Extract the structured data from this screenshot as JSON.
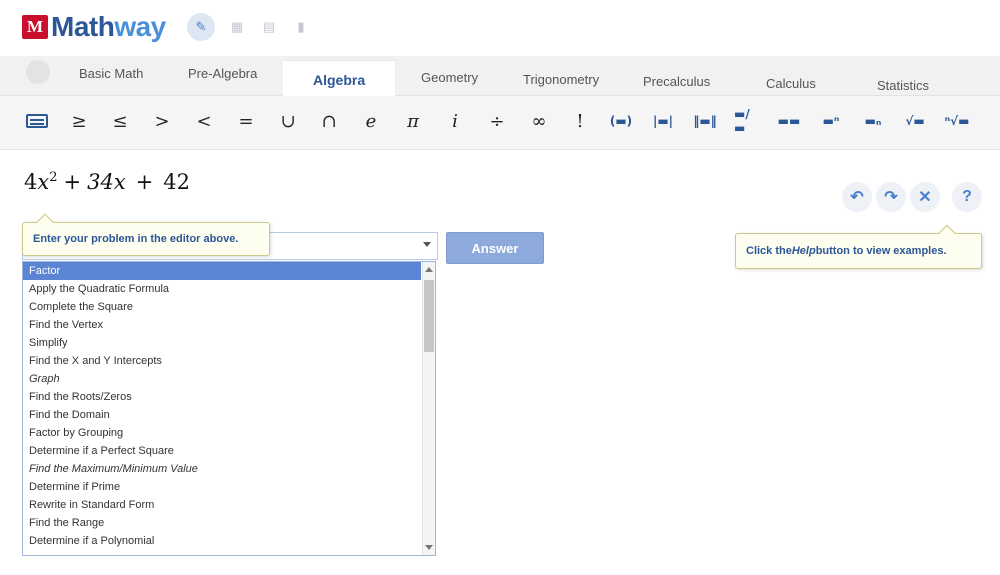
{
  "brand": {
    "mark": "M",
    "name_part1": "Math",
    "name_part2": "way",
    "mark_color": "#c8102e",
    "accent": "#2b5797"
  },
  "header_icons": [
    {
      "icon": "pencil-icon",
      "active": true
    },
    {
      "icon": "grid-icon",
      "active": false
    },
    {
      "icon": "calculator-icon",
      "active": false
    },
    {
      "icon": "trash-icon",
      "active": false
    }
  ],
  "tabs": [
    {
      "label": "Basic Math",
      "active": false
    },
    {
      "label": "Pre-Algebra",
      "active": false
    },
    {
      "label": "Algebra",
      "active": true
    },
    {
      "label": "Geometry",
      "active": false
    },
    {
      "label": "Trigonometry",
      "active": false
    },
    {
      "label": "Precalculus",
      "active": false
    },
    {
      "label": "Calculus",
      "active": false
    },
    {
      "label": "Statistics",
      "active": false
    }
  ],
  "toolbar": {
    "symbols": [
      "≥",
      "≤",
      ">",
      "<",
      "=",
      "∪",
      "∩",
      "e",
      "π",
      "i",
      "÷",
      "∞",
      "!"
    ],
    "structures": [
      "(▬)",
      "|▬|",
      "‖▬‖",
      "▬/▬",
      "▬▬",
      "▬ⁿ",
      "▬ₙ",
      "√▬",
      "ⁿ√▬"
    ]
  },
  "editor": {
    "expression": {
      "t1_coef": "4",
      "t1_var": "x",
      "t1_exp": "2",
      "op1": "+",
      "t2": "34x",
      "op2": "+",
      "t3": "42"
    }
  },
  "controls": {
    "undo": "↶",
    "redo": "↷",
    "clear": "✕",
    "help": "?"
  },
  "tooltips": {
    "editor_hint": "Enter your problem in the editor above.",
    "help_prefix": "Click the ",
    "help_word": "Help",
    "help_suffix": " button to view examples."
  },
  "answer_button": "Answer",
  "options": [
    "Factor",
    "Apply the Quadratic Formula",
    "Complete the Square",
    "Find the Vertex",
    "Simplify",
    "Find the X and Y Intercepts",
    "Graph",
    "Find the Roots/Zeros",
    "Find the Domain",
    "Factor by Grouping",
    "Determine if a Perfect Square",
    "Find the Maximum/Minimum Value",
    "Determine if Prime",
    "Rewrite in Standard Form",
    "Find the Range",
    "Determine if a Polynomial"
  ],
  "selected_option_index": 0
}
